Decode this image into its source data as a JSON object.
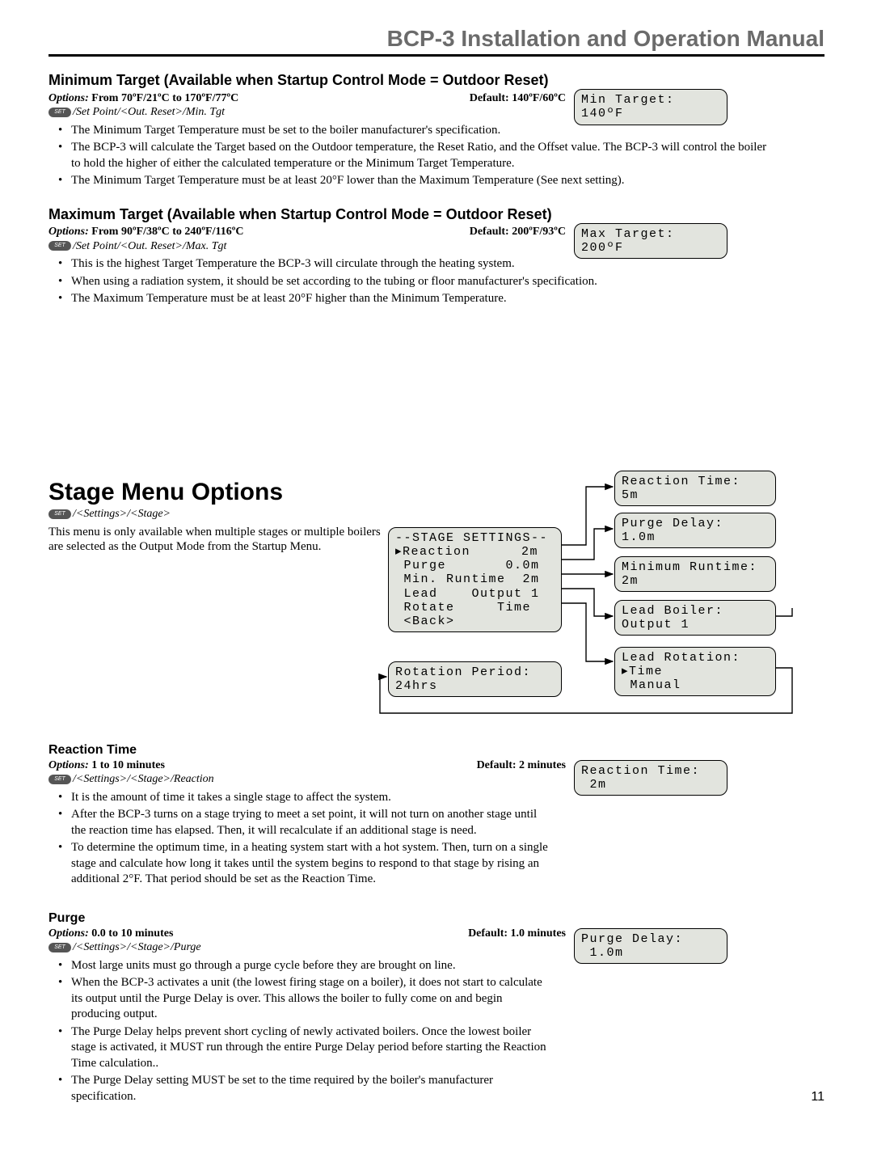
{
  "header": {
    "title": "BCP-3 Installation and Operation Manual"
  },
  "page_number": "11",
  "set_label": "SET",
  "min_target": {
    "heading": "Minimum Target (Available when Startup Control Mode = Outdoor Reset)",
    "options_label": "Options:",
    "options_value": "From 70ºF/21ºC to 170ºF/77ºC",
    "default_label": "Default: 140ºF/60ºC",
    "crumb": "/Set Point/<Out. Reset>/Min. Tgt",
    "bullets": [
      "The Minimum Target Temperature must be set to the boiler manufacturer's specification.",
      "The BCP-3 will calculate the Target based on the Outdoor temperature, the Reset Ratio, and the Offset value.  The BCP-3 will control the boiler to hold the higher of either the calculated temperature or the Minimum Target Temperature.",
      "The Minimum Target Temperature must be at least 20°F lower than the Maximum Temperature (See next setting)."
    ],
    "lcd": "Min Target:\n140ºF"
  },
  "max_target": {
    "heading": "Maximum Target (Available when Startup Control Mode = Outdoor Reset)",
    "options_label": "Options:",
    "options_value": "From 90ºF/38ºC to 240ºF/116ºC",
    "default_label": "Default: 200ºF/93ºC",
    "crumb": "/Set Point/<Out. Reset>/Max. Tgt",
    "bullets": [
      "This is the highest Target Temperature the BCP-3 will circulate through the heating system.",
      "When using a radiation system, it should be set according to the tubing or floor manufacturer's specification.",
      "The Maximum Temperature must be at least 20°F higher than the Minimum Temperature."
    ],
    "lcd": "Max Target:\n200ºF"
  },
  "stage_menu": {
    "title": "Stage Menu Options",
    "crumb": "/<Settings>/<Stage>",
    "desc": "This menu is only available when multiple stages or multiple boilers are selected as the Output Mode from the Startup Menu.",
    "diagram": {
      "main": "--STAGE SETTINGS--\n▸Reaction      2m\n Purge       0.0m\n Min. Runtime  2m\n Lead    Output 1\n Rotate     Time\n <Back>",
      "rotation": "Rotation Period:\n24hrs",
      "react": "Reaction Time:\n5m",
      "purge": "Purge Delay:\n1.0m",
      "minrun": "Minimum Runtime:\n2m",
      "lead": "Lead Boiler:\nOutput 1",
      "leadrot": "Lead Rotation:\n▸Time\n Manual"
    }
  },
  "reaction": {
    "heading": "Reaction Time",
    "options_label": "Options:",
    "options_value": "1 to 10 minutes",
    "default_label": "Default: 2 minutes",
    "crumb": "/<Settings>/<Stage>/Reaction",
    "bullets": [
      "It is the amount of time it takes a single stage to affect the system.",
      "After the BCP-3 turns on a stage trying to meet a set point, it will not turn on another stage until the reaction time has elapsed.  Then, it will recalculate if an additional stage is need.",
      "To determine the optimum time, in a heating system start with a hot system.  Then, turn on a single stage and calculate how long it takes until the system begins to respond to that stage by rising an additional 2°F.  That period should be set as the Reaction Time."
    ],
    "lcd": "Reaction Time:\n 2m"
  },
  "purge": {
    "heading": "Purge",
    "options_label": "Options:",
    "options_value": "0.0 to 10 minutes",
    "default_label": "Default: 1.0 minutes",
    "crumb": "/<Settings>/<Stage>/Purge",
    "bullets": [
      "Most large units must go through a purge cycle before they are brought on line.",
      "When the BCP-3 activates a unit (the lowest firing stage on a boiler), it does not start to calculate its output until the Purge Delay is over. This allows the boiler to fully come on and begin producing output.",
      "The Purge Delay helps prevent short cycling of newly activated boilers.  Once the lowest boiler stage is activated, it MUST run through the entire Purge Delay period before starting the Reaction Time calculation..",
      "The Purge Delay setting MUST be set to the time required by the boiler's manufacturer specification."
    ],
    "lcd": "Purge Delay:\n 1.0m"
  }
}
